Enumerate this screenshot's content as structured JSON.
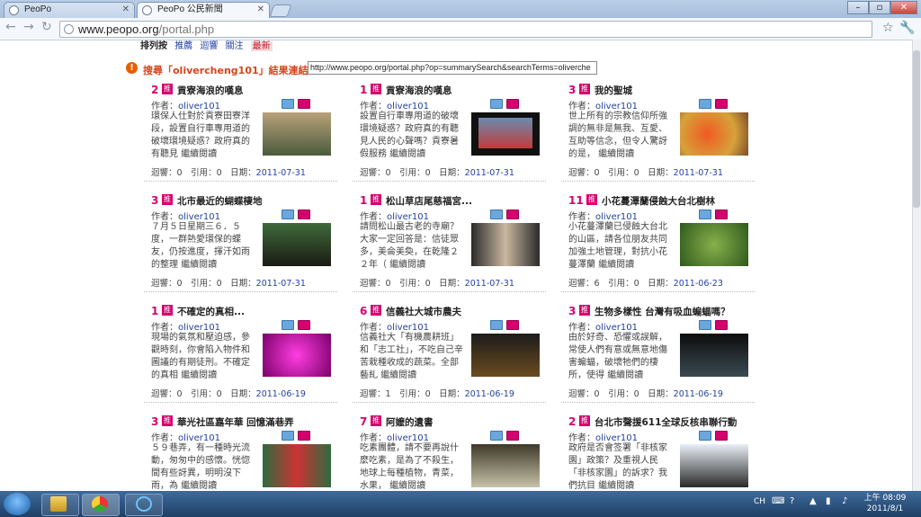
{
  "browser": {
    "tabs": [
      {
        "label": "PeoPo",
        "active": false
      },
      {
        "label": "PeoPo 公民新聞",
        "active": true
      }
    ],
    "url_host": "www.peopo.org",
    "url_path": "/portal.php"
  },
  "sortbar": {
    "label": "排列按",
    "options": [
      "推薦",
      "迴響",
      "關注",
      "最新"
    ],
    "current": "最新"
  },
  "search_notice": {
    "text": "搜尋「olivercheng101」結果連結：",
    "url": "http://www.peopo.org/portal.php?op=summarySearch&searchTerms=oliverche"
  },
  "stat_labels": {
    "reply": "迴響：",
    "cite": "引用：",
    "date": "日期："
  },
  "author_label": "作者：",
  "badge_text": "推",
  "read_more": "繼續閱讀",
  "articles": [
    {
      "votes": "2",
      "title": "貢寮海浪的嘆息",
      "author": "oliver101",
      "summary": "環保人仕對於貢寮田寮洋段，設置自行車專用道的破壞環境疑惑？政府真的有聽見",
      "replies": "0",
      "citations": "0",
      "date": "2011-07-31"
    },
    {
      "votes": "1",
      "title": "貢寮海浪的嘆息",
      "author": "oliver101",
      "summary": "設置自行車專用道的破壞環境疑惑？政府真的有聽見人民的心聲嗎？貢寮暑假服務",
      "replies": "0",
      "citations": "0",
      "date": "2011-07-31"
    },
    {
      "votes": "3",
      "title": "我的聖城",
      "author": "oliver101",
      "summary": "世上所有的宗教信仰所強調的無非是無我、互愛、互助等信念，但令人驚訝的是，",
      "replies": "0",
      "citations": "0",
      "date": "2011-07-31"
    },
    {
      "votes": "3",
      "title": "北市最近的蝴蝶棲地",
      "author": "oliver101",
      "summary": "７月５日星期三６．５度，一群熱愛環保的蝶友，仍按進度，揮汗如雨的整理",
      "replies": "0",
      "citations": "0",
      "date": "2011-07-31"
    },
    {
      "votes": "1",
      "title": "松山草店尾慈福宮...",
      "author": "oliver101",
      "summary": "請問松山最古老的寺廟？大家一定回答是：信徒眾多，美侖美奐，在乾隆２２年（",
      "replies": "0",
      "citations": "0",
      "date": "2011-07-31"
    },
    {
      "votes": "11",
      "title": "小花蔓澤蘭侵蝕大台北樹林",
      "author": "oliver101",
      "summary": "小花蔓澤蘭已侵蝕大台北的山區，請各位朋友共同加強土地管理，對抗小花蔓澤蘭",
      "replies": "6",
      "citations": "0",
      "date": "2011-06-23"
    },
    {
      "votes": "1",
      "title": "不確定的真相...",
      "author": "oliver101",
      "summary": "現場的氣氛和壓迫感，參觀時刻，你會陷入物件和圖議的有期徒刑。不確定的真相",
      "replies": "0",
      "citations": "0",
      "date": "2011-06-19"
    },
    {
      "votes": "6",
      "title": "信義社大城市農夫",
      "author": "oliver101",
      "summary": "信義社大「有機農耕班」和「志工社」，不吃自己辛苦栽種收成的蔬菜。全部藝糺",
      "replies": "1",
      "citations": "0",
      "date": "2011-06-19"
    },
    {
      "votes": "3",
      "title": "生物多樣性 台灣有吸血蝙蝠嗎？",
      "author": "oliver101",
      "summary": "由於好奇、恐懼或誤解，常使人們有意或無意地傷害蝙蝠，破壞牠們的棲所，使得",
      "replies": "0",
      "citations": "0",
      "date": "2011-06-19"
    },
    {
      "votes": "3",
      "title": "華光社區嘉年華 回憶滿巷弄",
      "author": "oliver101",
      "summary": "５９巷弄，有一種時光流動，匆匆中的感懷。恍惚間有些訝異，明明沒下雨，為",
      "replies": "",
      "citations": "",
      "date": ""
    },
    {
      "votes": "7",
      "title": "阿嬤的遺書",
      "author": "oliver101",
      "summary": "吃素團體，請不要再說什麼吃素，是為了不殺生，地球上每種植物，青菜，水果，",
      "replies": "",
      "citations": "",
      "date": ""
    },
    {
      "votes": "2",
      "title": "台北市聲援611全球反核串聯行動",
      "author": "oliver101",
      "summary": "政府是否會签署「非核家園」政策？及重視人民「非核家園」的訴求？我們抗目",
      "replies": "",
      "citations": "",
      "date": ""
    }
  ],
  "taskbar": {
    "lang": "CH",
    "time": "上午 08:09",
    "date": "2011/8/1"
  }
}
